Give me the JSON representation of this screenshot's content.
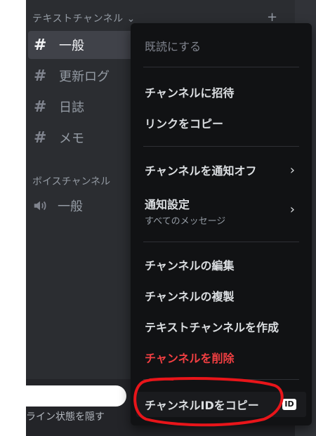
{
  "sidebar": {
    "text_category": "テキストチャンネル ⌄",
    "add_icon": "plus-icon",
    "channels": [
      {
        "icon": "#",
        "label": "一般",
        "selected": true
      },
      {
        "icon": "#",
        "label": "更新ログ",
        "selected": false
      },
      {
        "icon": "#",
        "label": "日誌",
        "selected": false
      },
      {
        "icon": "#",
        "label": "メモ",
        "selected": false
      }
    ],
    "voice_category": "ボイスチャンネル",
    "voice_channels": [
      {
        "icon": "speaker-icon",
        "label": "一般"
      }
    ],
    "status_text": "ライン状態を隠す"
  },
  "context_menu": {
    "mark_read": "既読にする",
    "invite": "チャンネルに招待",
    "copy_link": "リンクをコピー",
    "mute": "チャンネルを通知オフ",
    "notify_settings": "通知設定",
    "notify_settings_sub": "すべてのメッセージ",
    "edit": "チャンネルの編集",
    "duplicate": "チャンネルの複製",
    "create_text": "テキストチャンネルを作成",
    "delete": "チャンネルを削除",
    "copy_id": "チャンネルIDをコピー",
    "id_badge": "ID"
  },
  "colors": {
    "sidebar_bg": "#2b2d31",
    "menu_bg": "#111214",
    "danger": "#f23f42",
    "annotation": "#e8151a"
  }
}
